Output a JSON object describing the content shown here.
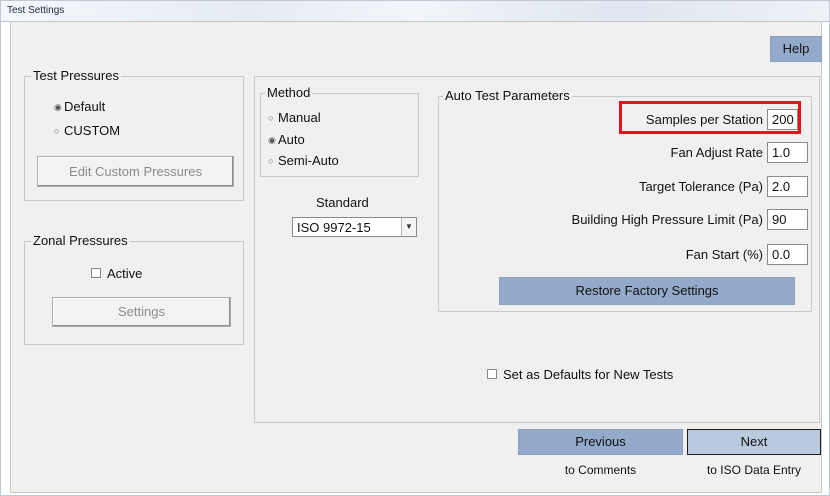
{
  "window": {
    "title": "Test Settings"
  },
  "help_button": "Help",
  "test_pressures": {
    "title": "Test Pressures",
    "options": [
      "Default",
      "CUSTOM"
    ],
    "selected": "Default",
    "edit_button": "Edit Custom Pressures"
  },
  "zonal_pressures": {
    "title": "Zonal Pressures",
    "active_label": "Active",
    "active_checked": false,
    "settings_button": "Settings"
  },
  "method": {
    "title": "Method",
    "options": [
      "Manual",
      "Auto",
      "Semi-Auto"
    ],
    "selected": "Auto"
  },
  "standard": {
    "label": "Standard",
    "value": "ISO 9972-15"
  },
  "auto_test": {
    "title": "Auto Test Parameters",
    "params": [
      {
        "label": "Samples per Station",
        "value": "200",
        "highlighted": true
      },
      {
        "label": "Fan Adjust Rate",
        "value": "1.0"
      },
      {
        "label": "Target Tolerance (Pa)",
        "value": "2.0"
      },
      {
        "label": "Building High Pressure Limit (Pa)",
        "value": "90"
      },
      {
        "label": "Fan Start (%)",
        "value": "0.0"
      }
    ],
    "restore_button": "Restore Factory Settings"
  },
  "defaults_checkbox": {
    "label": "Set as Defaults for New Tests",
    "checked": false
  },
  "nav": {
    "previous": "Previous",
    "previous_sub": "to Comments",
    "next": "Next",
    "next_sub": "to ISO Data Entry"
  },
  "colors": {
    "highlight": "#e8121a",
    "button_blue": "#93aacb",
    "next_button": "#b9c9de"
  }
}
